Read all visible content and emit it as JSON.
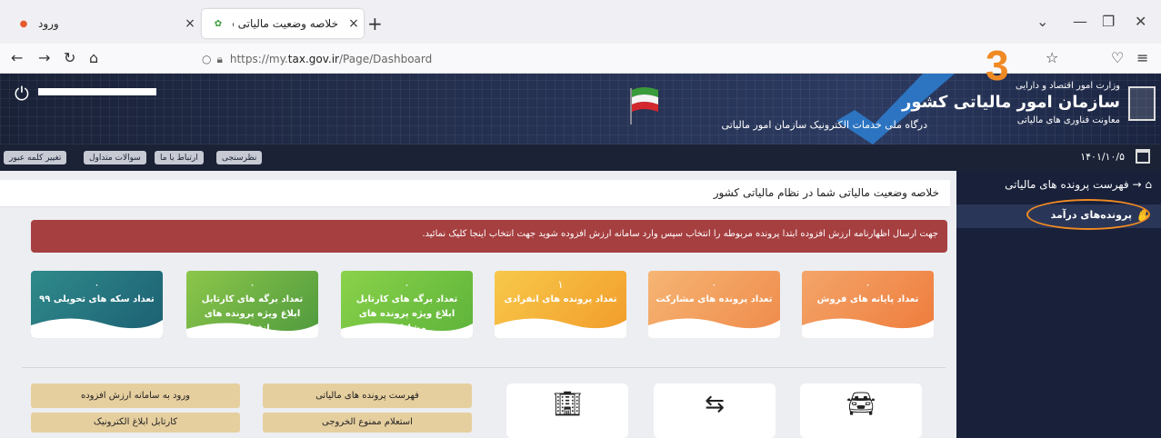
{
  "browser": {
    "tabs": [
      {
        "title": "ورود"
      },
      {
        "title": "خلاصه وضعیت مالیاتی شما در نظام مالیاتی"
      }
    ],
    "url_prefix": "https://my.",
    "url_domain": "tax.gov.ir",
    "url_path": "/Page/Dashboard",
    "new_tab": "+",
    "close": "×"
  },
  "header": {
    "org_line1": "وزارت امور اقتصاد و دارایی",
    "org_line2": "سازمان امور مالیاتی کشور",
    "org_line3": "معاونت فناوری های مالیاتی",
    "portal_title": "درگاه ملی خدمات الکترونیک سازمان امور مالیاتی"
  },
  "topmenu": {
    "date": "۱۴۰۱/۱۰/۵",
    "buttons": [
      "نظرسنجی",
      "ارتباط با ما",
      "سوالات متداول",
      "تغییر کلمه عبور"
    ]
  },
  "sidebar": {
    "title": "فهرست پرونده های مالیاتی",
    "item": "پرونده‌های درآمد",
    "annotation": "3"
  },
  "main": {
    "title": "خلاصه وضعیت مالیاتی شما در نظام مالیاتی کشور",
    "alert": "جهت ارسال اظهارنامه ارزش افزوده ابتدا پرونده مربوطه را انتخاب سپس وارد سامانه ارزش افزوده شوید جهت انتخاب اینجا کلیک نمائید.",
    "stats": [
      {
        "value": "۰",
        "label": "تعداد پایانه های فروش"
      },
      {
        "value": "۰",
        "label": "تعداد پرونده های مشارکت"
      },
      {
        "value": "۱",
        "label": "تعداد پرونده های انفرادی"
      },
      {
        "value": "۰",
        "label": "تعداد برگه های کارتابل ابلاغ ویژه پرونده های مشارکت"
      },
      {
        "value": "۰",
        "label": "تعداد برگه های کارتابل ابلاغ ویژه پرونده های انفرادی"
      },
      {
        "value": "۰",
        "label": "تعداد سکه های تحویلی ۹۹"
      }
    ],
    "quick_links": [
      "ورود به سامانه ارزش افزوده",
      "فهرست پرونده های مالیاتی",
      "کارتابل ابلاغ الکترونیک",
      "استعلام ممنوع الخروجی"
    ]
  },
  "colors": {
    "alert": "#a63f40",
    "sidebar": "#18203a",
    "annotation": "#f08a24"
  }
}
